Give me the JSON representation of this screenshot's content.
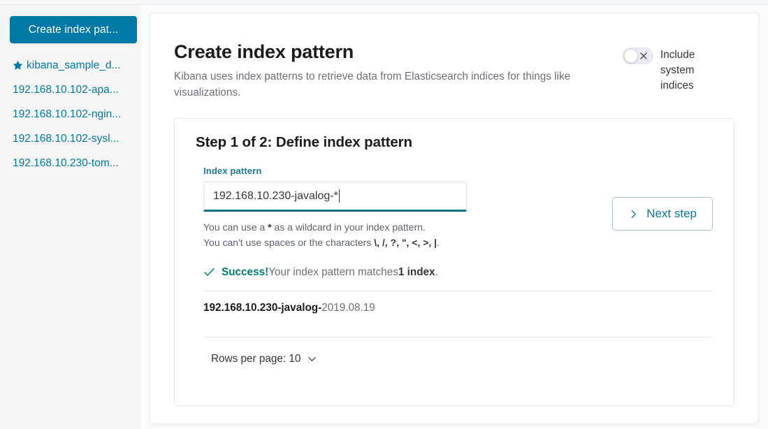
{
  "sidebar": {
    "create_button_label": "Create index pat...",
    "items": [
      {
        "label": "kibana_sample_d...",
        "icon": "star-icon",
        "starred": true
      },
      {
        "label": "192.168.10.102-apa...",
        "starred": false
      },
      {
        "label": "192.168.10.102-ngin...",
        "starred": false
      },
      {
        "label": "192.168.10.102-sysl...",
        "starred": false
      },
      {
        "label": "192.168.10.230-tom...",
        "starred": false
      }
    ]
  },
  "header": {
    "title": "Create index pattern",
    "description": "Kibana uses index patterns to retrieve data from Elasticsearch indices for things like visualizations.",
    "toggle": {
      "label": "Include system indices",
      "state": "off",
      "icon": "close-x-icon"
    }
  },
  "step": {
    "title": "Step 1 of 2: Define index pattern",
    "field_label": "Index pattern",
    "input_value": "192.168.10.230-javalog-*",
    "input_placeholder": "index-name-*",
    "hint_line1_before": "You can use a ",
    "hint_line1_bold": "*",
    "hint_line1_after": " as a wildcard in your index pattern.",
    "hint_line2_before": "You can't use spaces or the characters ",
    "hint_line2_bold": "\\, /, ?, \", <, >, |",
    "hint_line2_after": ".",
    "next_button_label": "Next step",
    "next_button_icon": "chevron-right-icon"
  },
  "success": {
    "icon": "check-icon",
    "strong": "Success!",
    "middle": " Your index pattern matches ",
    "count": "1 index",
    "period": "."
  },
  "results": {
    "rows": [
      {
        "bold_prefix": "192.168.10.230-javalog-",
        "suffix": "2019.08.19"
      }
    ],
    "rows_per_page_label": "Rows per page: 10",
    "rows_per_page_icon": "chevron-down-icon"
  },
  "colors": {
    "accent": "#0079a5",
    "link": "#0079a5",
    "success": "#017d73",
    "input_focus_underline": "#0d7289",
    "field_label": "#1d7b93",
    "sidebar_bg": "#f5f5f5",
    "page_bg": "#fafbfd"
  }
}
